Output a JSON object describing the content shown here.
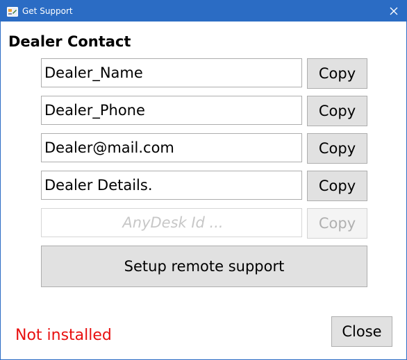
{
  "window": {
    "title": "Get Support",
    "titlebar_color": "#2b6cc4"
  },
  "heading": "Dealer Contact",
  "fields": [
    {
      "value": "Dealer_Name",
      "copy_label": "Copy"
    },
    {
      "value": "Dealer_Phone",
      "copy_label": "Copy"
    },
    {
      "value": "Dealer@mail.com",
      "copy_label": "Copy"
    },
    {
      "value": "Dealer Details.",
      "copy_label": "Copy"
    }
  ],
  "anydesk": {
    "placeholder": "AnyDesk Id ...",
    "copy_label": "Copy"
  },
  "setup_button_label": "Setup remote support",
  "status_text": "Not installed",
  "status_color": "#e81010",
  "close_button_label": "Close"
}
